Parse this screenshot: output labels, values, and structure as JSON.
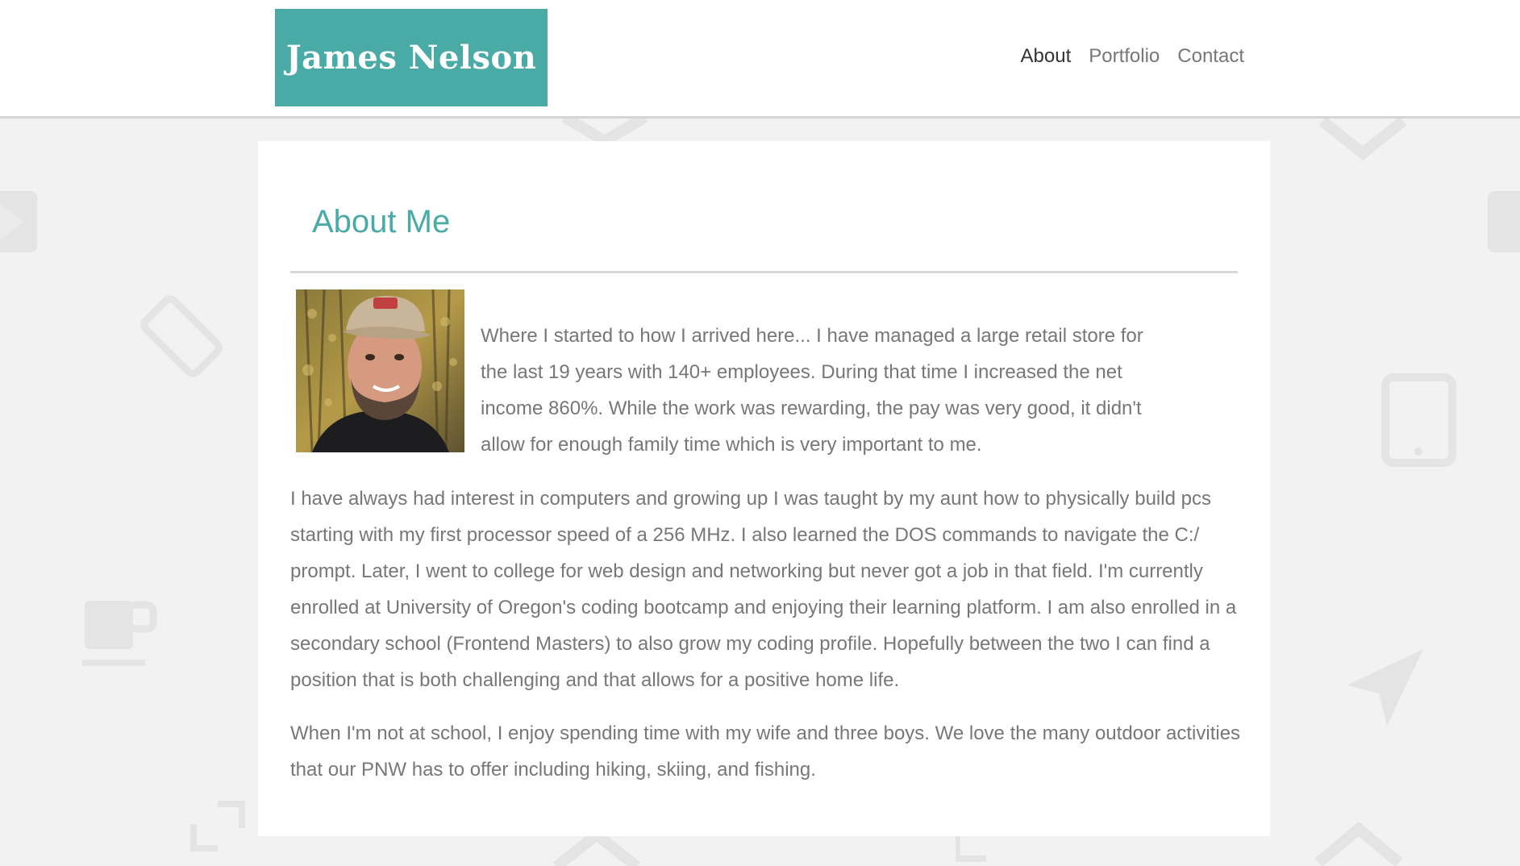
{
  "header": {
    "brand": "James Nelson",
    "nav": [
      {
        "label": "About",
        "active": true
      },
      {
        "label": "Portfolio",
        "active": false
      },
      {
        "label": "Contact",
        "active": false
      }
    ]
  },
  "main": {
    "title": "About Me",
    "photo_alt": "profile-photo",
    "paragraphs": [
      "Where I started to how I arrived here... I have managed a large retail store for the last 19 years with 140+ employees. During that time I increased the net income 860%. While the work was rewarding, the pay was very good, it didn't allow for enough family time which is very important to me.",
      "I have always had interest in computers and growing up I was taught by my aunt how to physically build pcs starting with my first processor speed of a 256 MHz. I also learned the DOS commands to navigate the C:/ prompt. Later, I went to college for web design and networking but never got a job in that field. I'm currently enrolled at University of Oregon's coding bootcamp and enjoying their learning platform. I am also enrolled in a secondary school (Frontend Masters) to also grow my coding profile. Hopefully between the two I can find a position that is both challenging and that allows for a positive home life.",
      "When I'm not at school, I enjoy spending time with my wife and three boys. We love the many outdoor activities that our PNW has to offer including hiking, skiing, and fishing."
    ]
  },
  "colors": {
    "accent": "#4aaba6",
    "background": "#f2f2f2",
    "text": "#777777"
  }
}
